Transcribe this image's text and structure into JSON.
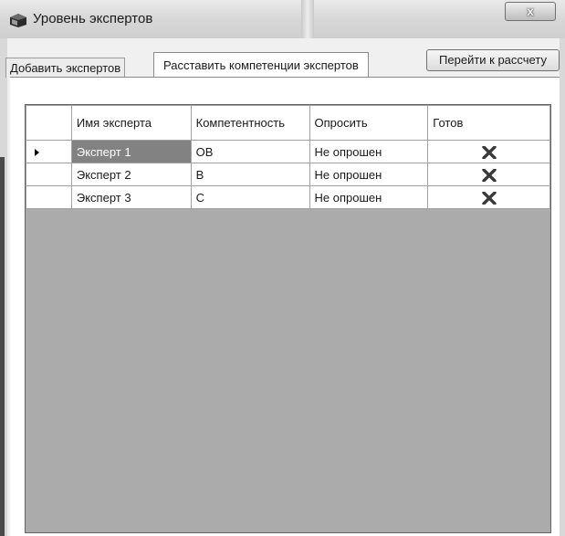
{
  "window": {
    "title": "Уровень экспертов",
    "close_label": "x"
  },
  "tabs": [
    {
      "label": "Добавить экспертов",
      "active": false
    },
    {
      "label": "Расставить компетенции экспертов",
      "active": true
    }
  ],
  "toolbar": {
    "calculate_label": "Перейти к рассчету"
  },
  "grid": {
    "columns": {
      "name": "Имя эксперта",
      "competence": "Компетентность",
      "ask": "Опросить",
      "ready": "Готов"
    },
    "rows": [
      {
        "name": "Эксперт 1",
        "competence": "ОВ",
        "ask": "Не опрошен",
        "ready_icon": "x-icon",
        "current": true
      },
      {
        "name": "Эксперт 2",
        "competence": "В",
        "ask": "Не опрошен",
        "ready_icon": "x-icon",
        "current": false
      },
      {
        "name": "Эксперт 3",
        "competence": "С",
        "ask": "Не опрошен",
        "ready_icon": "x-icon",
        "current": false
      }
    ]
  },
  "colors": {
    "grid_background": "#ababab",
    "selected_cell": "#828282",
    "ready_icon": "#3a3a3a"
  }
}
